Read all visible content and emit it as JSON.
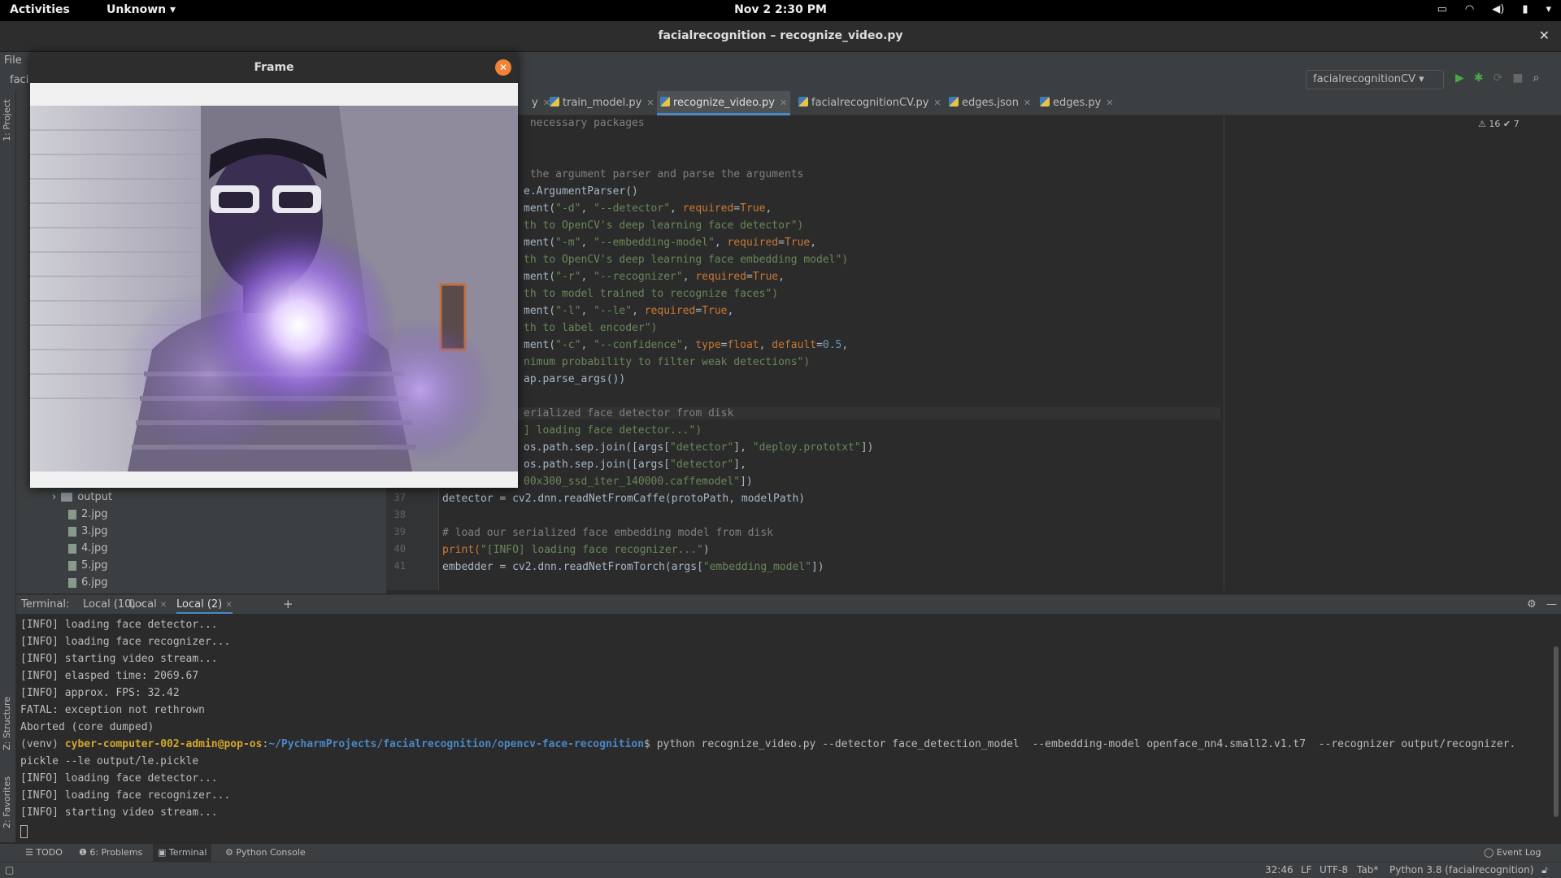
{
  "topbar": {
    "activities": "Activities",
    "app_menu": "Unknown ▾",
    "clock": "Nov 2  2:30 PM"
  },
  "window": {
    "title": "facialrecognition – recognize_video.py",
    "close_glyph": "✕"
  },
  "ide": {
    "menu_file": "File",
    "breadcrumb": "faci",
    "run_config": "facialrecognitionCV ▾",
    "left_strip": {
      "project": "1: Project",
      "structure": "Z: Structure",
      "favorites": "2: Favorites"
    },
    "warnings": "⚠ 16  ✔ 7"
  },
  "editor_tabs": [
    {
      "label": "y"
    },
    {
      "label": "train_model.py"
    },
    {
      "label": "recognize_video.py",
      "active": true
    },
    {
      "label": "facialrecognitionCV.py"
    },
    {
      "label": "edges.json"
    },
    {
      "label": "edges.py"
    }
  ],
  "project_tree": {
    "folder": "output",
    "files": [
      "2.jpg",
      "3.jpg",
      "4.jpg",
      "5.jpg",
      "6.jpg"
    ]
  },
  "code": {
    "l0": " necessary packages",
    "l1a": " the argument parser and parse the arguments",
    "l2a": "e.ArgumentParser()",
    "l3a": "ment(",
    "l3b": "\"-d\"",
    "l3c": ", ",
    "l3d": "\"--detector\"",
    "l3e": ", ",
    "l3f": "required",
    "l3g": "=",
    "l3h": "True",
    "l3i": ",",
    "l4a": "th to OpenCV's deep learning face detector\")",
    "l5a": "ment(",
    "l5b": "\"-m\"",
    "l5c": ", ",
    "l5d": "\"--embedding-model\"",
    "l5e": ", ",
    "l5f": "required",
    "l5g": "=",
    "l5h": "True",
    "l5i": ",",
    "l6a": "th to OpenCV's deep learning face embedding model\")",
    "l7a": "ment(",
    "l7b": "\"-r\"",
    "l7c": ", ",
    "l7d": "\"--recognizer\"",
    "l7e": ", ",
    "l7f": "required",
    "l7g": "=",
    "l7h": "True",
    "l7i": ",",
    "l8a": "th to model trained to recognize faces\")",
    "l9a": "ment(",
    "l9b": "\"-l\"",
    "l9c": ", ",
    "l9d": "\"--le\"",
    "l9e": ", ",
    "l9f": "required",
    "l9g": "=",
    "l9h": "True",
    "l9i": ",",
    "l10a": "th to label encoder\")",
    "l11a": "ment(",
    "l11b": "\"-c\"",
    "l11c": ", ",
    "l11d": "\"--confidence\"",
    "l11e": ", ",
    "l11f": "type",
    "l11g": "=",
    "l11h": "float",
    "l11i": ", ",
    "l11j": "default",
    "l11k": "=",
    "l11l": "0.5",
    "l11m": ",",
    "l12a": "nimum probability to filter weak detections\")",
    "l13a": "ap.parse_args())",
    "l15a": "erialized face detector from disk",
    "l16a": "] loading face detector...\")",
    "l17a": "os.path.sep.join([args[",
    "l17b": "\"detector\"",
    "l17c": "], ",
    "l17d": "\"deploy.prototxt\"",
    "l17e": "])",
    "l18a": "os.path.sep.join([args[",
    "l18b": "\"detector\"",
    "l18c": "],",
    "l19a": "00x300_ssd_iter_140000.caffemodel\"",
    "l19b": "])",
    "l20": "detector = cv2.dnn.readNetFromCaffe(protoPath, modelPath)",
    "l22": "# load our serialized face embedding model from disk",
    "l23a": "print(",
    "l23b": "\"[INFO] loading face recognizer...\"",
    "l23c": ")",
    "l24a": "embedder = cv2.dnn.readNetFromTorch(args[",
    "l24b": "\"embedding_model\"",
    "l24c": "])"
  },
  "line_numbers": [
    "37",
    "38",
    "39",
    "40",
    "41"
  ],
  "terminal_tabs": {
    "label": "Terminal:",
    "tabs": [
      "Local (10)",
      "Local",
      "Local (2)"
    ],
    "add": "+"
  },
  "terminal": {
    "lines": [
      "[INFO] loading face detector...",
      "[INFO] loading face recognizer...",
      "[INFO] starting video stream...",
      "[INFO] elasped time: 2069.67",
      "[INFO] approx. FPS: 32.42",
      "FATAL: exception not rethrown",
      "Aborted (core dumped)"
    ],
    "prompt_venv": "(venv) ",
    "prompt_user": "cyber-computer-002-admin@pop-os",
    "prompt_sep": ":",
    "prompt_path": "~/PycharmProjects/facialrecognition/opencv-face-recognition",
    "prompt_cmd": "$ python recognize_video.py --detector face_detection_model  --embedding-model openface_nn4.small2.v1.t7  --recognizer output/recognizer.",
    "cmd_cont": "pickle --le output/le.pickle",
    "lines2": [
      "[INFO] loading face detector...",
      "[INFO] loading face recognizer...",
      "[INFO] starting video stream..."
    ]
  },
  "tool_tabs": {
    "todo": "☰ TODO",
    "problems": "❶ 6: Problems",
    "terminal": "▣ Terminal",
    "python_console": "⚙ Python Console",
    "event_log": "◯ Event Log"
  },
  "status": {
    "position": "32:46",
    "line_sep": "LF",
    "encoding": "UTF-8",
    "indent": "Tab*",
    "interpreter": "Python 3.8 (facialrecognition)"
  },
  "frame_window": {
    "title": "Frame",
    "close_glyph": "✕"
  },
  "colors": {
    "accent": "#4a88c7",
    "run_green": "#49a845",
    "frame_close": "#f08336",
    "glow": "#b48cff"
  }
}
